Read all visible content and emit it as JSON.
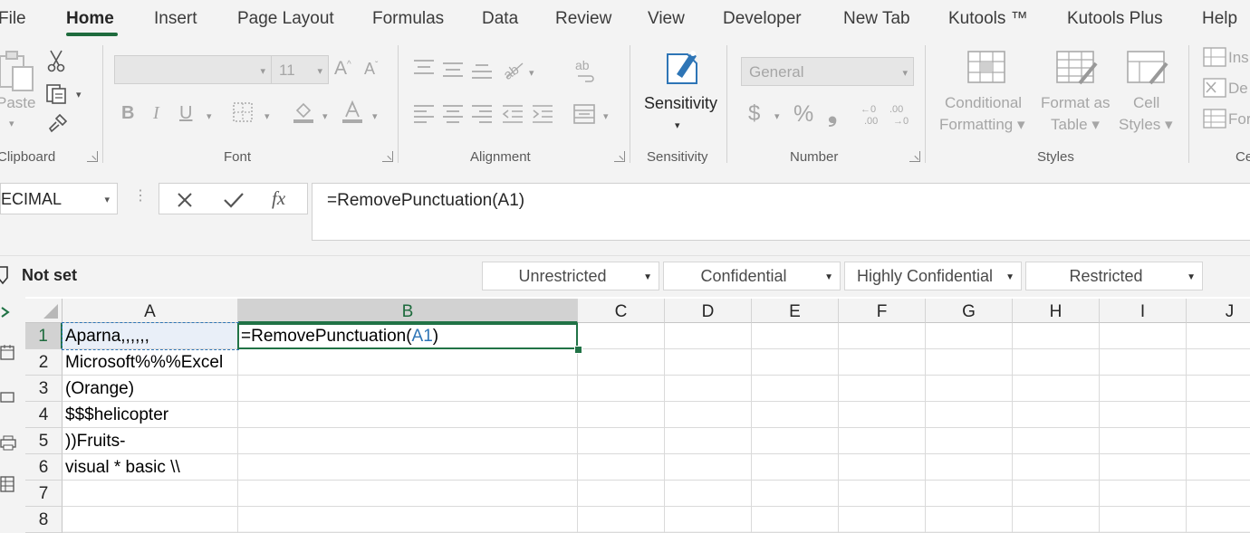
{
  "menu": {
    "tabs": [
      "File",
      "Home",
      "Insert",
      "Page Layout",
      "Formulas",
      "Data",
      "Review",
      "View",
      "Developer",
      "New Tab",
      "Kutools ™",
      "Kutools Plus",
      "Help"
    ],
    "active": "Home"
  },
  "ribbon": {
    "clipboard": {
      "paste": "Paste",
      "label": "Clipboard"
    },
    "font": {
      "name": "",
      "size": "11",
      "label": "Font"
    },
    "alignment": {
      "label": "Alignment"
    },
    "sensitivity": {
      "button": "Sensitivity",
      "label": "Sensitivity"
    },
    "number": {
      "format": "General",
      "currency": "$",
      "percent": "%",
      "comma": "❟",
      "label": "Number"
    },
    "styles": {
      "conditional_line1": "Conditional",
      "conditional_line2": "Formatting",
      "format_table_line1": "Format as",
      "format_table_line2": "Table",
      "cell_styles_line1": "Cell",
      "cell_styles_line2": "Styles",
      "label": "Styles"
    },
    "cells": {
      "insert": "Ins",
      "delete": "De",
      "format": "For",
      "label": "Ce"
    }
  },
  "formula_bar": {
    "name_box": "ECIMAL",
    "fx": "fx",
    "formula": "=RemovePunctuation(A1)"
  },
  "sensitivity_bar": {
    "status": "Not set",
    "labels": [
      "Unrestricted",
      "Confidential",
      "Highly Confidential",
      "Restricted"
    ]
  },
  "sheet": {
    "columns": [
      "A",
      "B",
      "C",
      "D",
      "E",
      "F",
      "G",
      "H",
      "I",
      "J"
    ],
    "rows": [
      "1",
      "2",
      "3",
      "4",
      "5",
      "6",
      "7",
      "8"
    ],
    "column_a": [
      "Aparna,,,,,,",
      "Microsoft%%%Excel",
      "(Orange)",
      "$$$helicopter",
      "))Fruits-",
      "visual * basic \\\\",
      "",
      ""
    ],
    "b1": {
      "prefix": "=RemovePunctuation(",
      "ref": "A1",
      "suffix": ")"
    },
    "active_cell": "B1",
    "ref_color": "#2e75b6"
  }
}
